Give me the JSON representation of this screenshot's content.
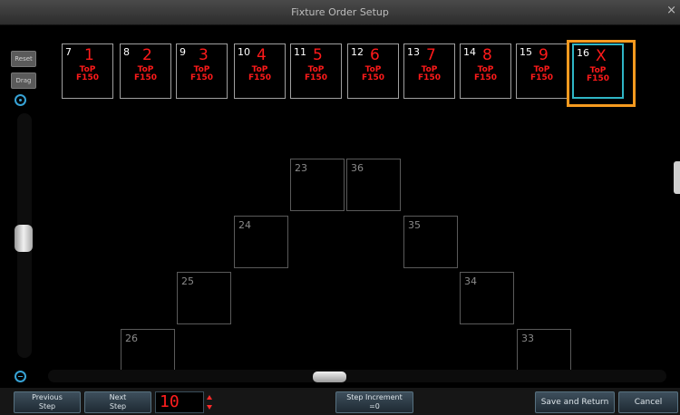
{
  "window": {
    "title": "Fixture Order Setup",
    "close_glyph": "×"
  },
  "sidebar": {
    "reset_label": "Reset",
    "drag_label": "Drag"
  },
  "fixtures": [
    {
      "number": "7",
      "order": "1",
      "logo_top": "ToP",
      "logo_bottom": "F150"
    },
    {
      "number": "8",
      "order": "2",
      "logo_top": "ToP",
      "logo_bottom": "F150"
    },
    {
      "number": "9",
      "order": "3",
      "logo_top": "ToP",
      "logo_bottom": "F150"
    },
    {
      "number": "10",
      "order": "4",
      "logo_top": "ToP",
      "logo_bottom": "F150"
    },
    {
      "number": "11",
      "order": "5",
      "logo_top": "ToP",
      "logo_bottom": "F150"
    },
    {
      "number": "12",
      "order": "6",
      "logo_top": "ToP",
      "logo_bottom": "F150"
    },
    {
      "number": "13",
      "order": "7",
      "logo_top": "ToP",
      "logo_bottom": "F150"
    },
    {
      "number": "14",
      "order": "8",
      "logo_top": "ToP",
      "logo_bottom": "F150"
    },
    {
      "number": "15",
      "order": "9",
      "logo_top": "ToP",
      "logo_bottom": "F150"
    },
    {
      "number": "16",
      "order": "X",
      "logo_top": "ToP",
      "logo_bottom": "F150",
      "selected": true
    }
  ],
  "grid_cells": [
    "23",
    "36",
    "24",
    "35",
    "25",
    "34",
    "26",
    "33"
  ],
  "bottom": {
    "previous_step": [
      "Previous",
      "Step"
    ],
    "next_step": [
      "Next",
      "Step"
    ],
    "step_value": "10",
    "step_increment": [
      "Step Increment",
      "=0"
    ],
    "save_return": "Save and Return",
    "cancel": "Cancel"
  },
  "colors": {
    "accent": "#37a3d6",
    "highlight": "#f59a1f",
    "order_text": "#ff1a1a",
    "selected_border": "#2fb6c6"
  }
}
